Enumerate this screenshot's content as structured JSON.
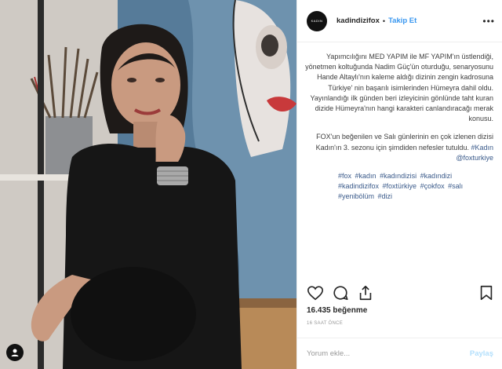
{
  "header": {
    "avatar_text": "KADIN",
    "username": "kadindizifox",
    "separator": "•",
    "follow_label": "Takip Et",
    "more_label": "•••"
  },
  "caption": {
    "paragraph1": "Yapımcılığını MED YAPIM ile MF YAPIM'ın üstlendiği, yönetmen koltuğunda Nadim Güç'ün oturduğu, senaryosunu Hande Altaylı'nın kaleme aldığı dizinin zengin kadrosuna Türkiye' nin başarılı isimlerinden Hümeyra dahil oldu. Yayınlandığı ilk günden beri izleyicinin gönlünde taht kuran dizide Hümeyra'nın hangi karakteri canlandıracağı merak konusu.",
    "paragraph2_text": "FOX'un beğenilen ve Salı günlerinin en çok izlenen dizisi Kadın'ın 3. sezonu için şimdiden nefesler tutuldu.",
    "paragraph2_hashtag": "#Kadın",
    "paragraph2_mention": "@foxturkiye",
    "hashtags": [
      "#fox",
      "#kadın",
      "#kadındizisi",
      "#kadındizi",
      "#kadindizifox",
      "#foxtürkiye",
      "#çokfox",
      "#salı",
      "#yenibölüm",
      "#dizi"
    ]
  },
  "actions": {
    "like_icon": "heart-icon",
    "comment_icon": "comment-icon",
    "share_icon": "share-icon",
    "save_icon": "bookmark-icon"
  },
  "stats": {
    "likes": "16.435 beğenme",
    "time": "16 SAAT ÖNCE"
  },
  "comment": {
    "placeholder": "Yorum ekle...",
    "post_label": "Paylaş"
  },
  "colors": {
    "link": "#3897f0",
    "hashtag": "#3a5a8a"
  }
}
